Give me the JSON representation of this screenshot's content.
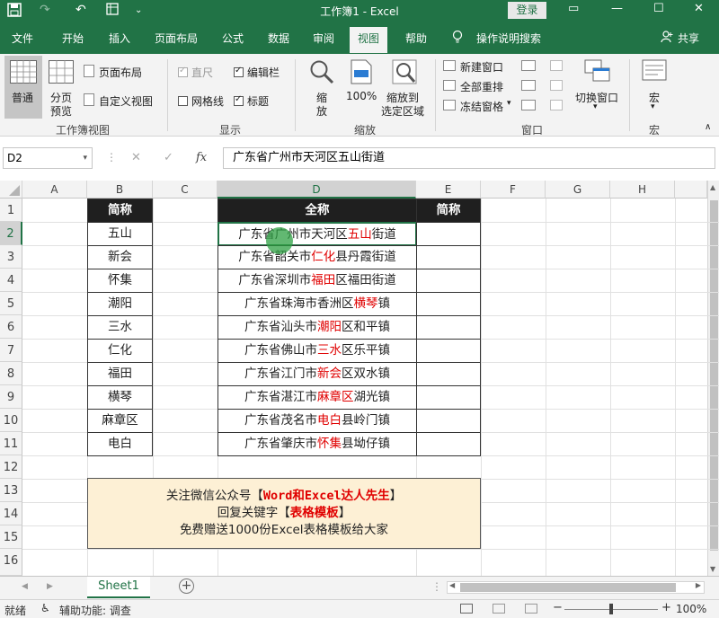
{
  "titlebar": {
    "doc_title": "工作簿1 - Excel",
    "login_label": "登录"
  },
  "tabs": [
    "文件",
    "开始",
    "插入",
    "页面布局",
    "公式",
    "数据",
    "审阅",
    "视图",
    "帮助"
  ],
  "active_tab": "视图",
  "tell_me": "操作说明搜索",
  "share_label": "共享",
  "ribbon": {
    "workbook_views": {
      "normal": "普通",
      "page_break_line1": "分页",
      "page_break_line2": "预览",
      "page_layout": "页面布局",
      "custom_views": "自定义视图",
      "label": "工作簿视图"
    },
    "show": {
      "ruler": "直尺",
      "formula_bar": "编辑栏",
      "gridlines": "网格线",
      "headings": "标题",
      "label": "显示"
    },
    "zoom": {
      "zoom_line1": "缩",
      "zoom_line2": "放",
      "zoom100": "100%",
      "zoom_sel_line1": "缩放到",
      "zoom_sel_line2": "选定区域",
      "label": "缩放"
    },
    "window": {
      "new_window": "新建窗口",
      "arrange_all": "全部重排",
      "freeze_panes": "冻结窗格",
      "switch_windows": "切换窗口",
      "label": "窗口"
    },
    "macros": {
      "macro_btn": "宏",
      "label": "宏"
    }
  },
  "formula_bar": {
    "name_box": "D2",
    "content": "广东省广州市天河区五山街道"
  },
  "columns": [
    "A",
    "B",
    "C",
    "D",
    "E",
    "F",
    "G",
    "H"
  ],
  "rows": [
    "1",
    "2",
    "3",
    "4",
    "5",
    "6",
    "7",
    "8",
    "9",
    "10",
    "11",
    "12",
    "13",
    "14",
    "15",
    "16"
  ],
  "table_b": {
    "header": "简称",
    "items": [
      "五山",
      "新会",
      "怀集",
      "潮阳",
      "三水",
      "仁化",
      "福田",
      "横琴",
      "麻章区",
      "电白"
    ]
  },
  "table_de": {
    "header_d": "全称",
    "header_e": "简称",
    "rows": [
      {
        "pre": "广东省广州市天河区",
        "hl": "五山",
        "post": "街道"
      },
      {
        "pre": "广东省韶关市",
        "hl": "仁化",
        "post": "县丹霞街道"
      },
      {
        "pre": "广东省深圳市",
        "hl": "福田",
        "post": "区福田街道"
      },
      {
        "pre": "广东省珠海市香洲区",
        "hl": "横琴",
        "post": "镇"
      },
      {
        "pre": "广东省汕头市",
        "hl": "潮阳",
        "post": "区和平镇"
      },
      {
        "pre": "广东省佛山市",
        "hl": "三水",
        "post": "区乐平镇"
      },
      {
        "pre": "广东省江门市",
        "hl": "新会",
        "post": "区双水镇"
      },
      {
        "pre": "广东省湛江市",
        "hl": "麻章区",
        "post": "湖光镇"
      },
      {
        "pre": "广东省茂名市",
        "hl": "电白",
        "post": "县岭门镇"
      },
      {
        "pre": "广东省肇庆市",
        "hl": "怀集",
        "post": "县坳仔镇"
      }
    ]
  },
  "note": {
    "line1_pre": "关注微信公众号【",
    "line1_hl": "Word和Excel达人先生",
    "line1_post": "】",
    "line2_pre": "回复关键字【",
    "line2_hl": "表格模板",
    "line2_post": "】",
    "line3": "免费赠送1000份Excel表格模板给大家"
  },
  "sheet_tab": "Sheet1",
  "status": {
    "ready": "就绪",
    "accessibility": "辅助功能: 调查",
    "zoom": "100%"
  },
  "colors": {
    "brand": "#217346",
    "highlight": "#e00000",
    "header_bg": "#1f1f1f",
    "note_bg": "#fdf0d5"
  }
}
